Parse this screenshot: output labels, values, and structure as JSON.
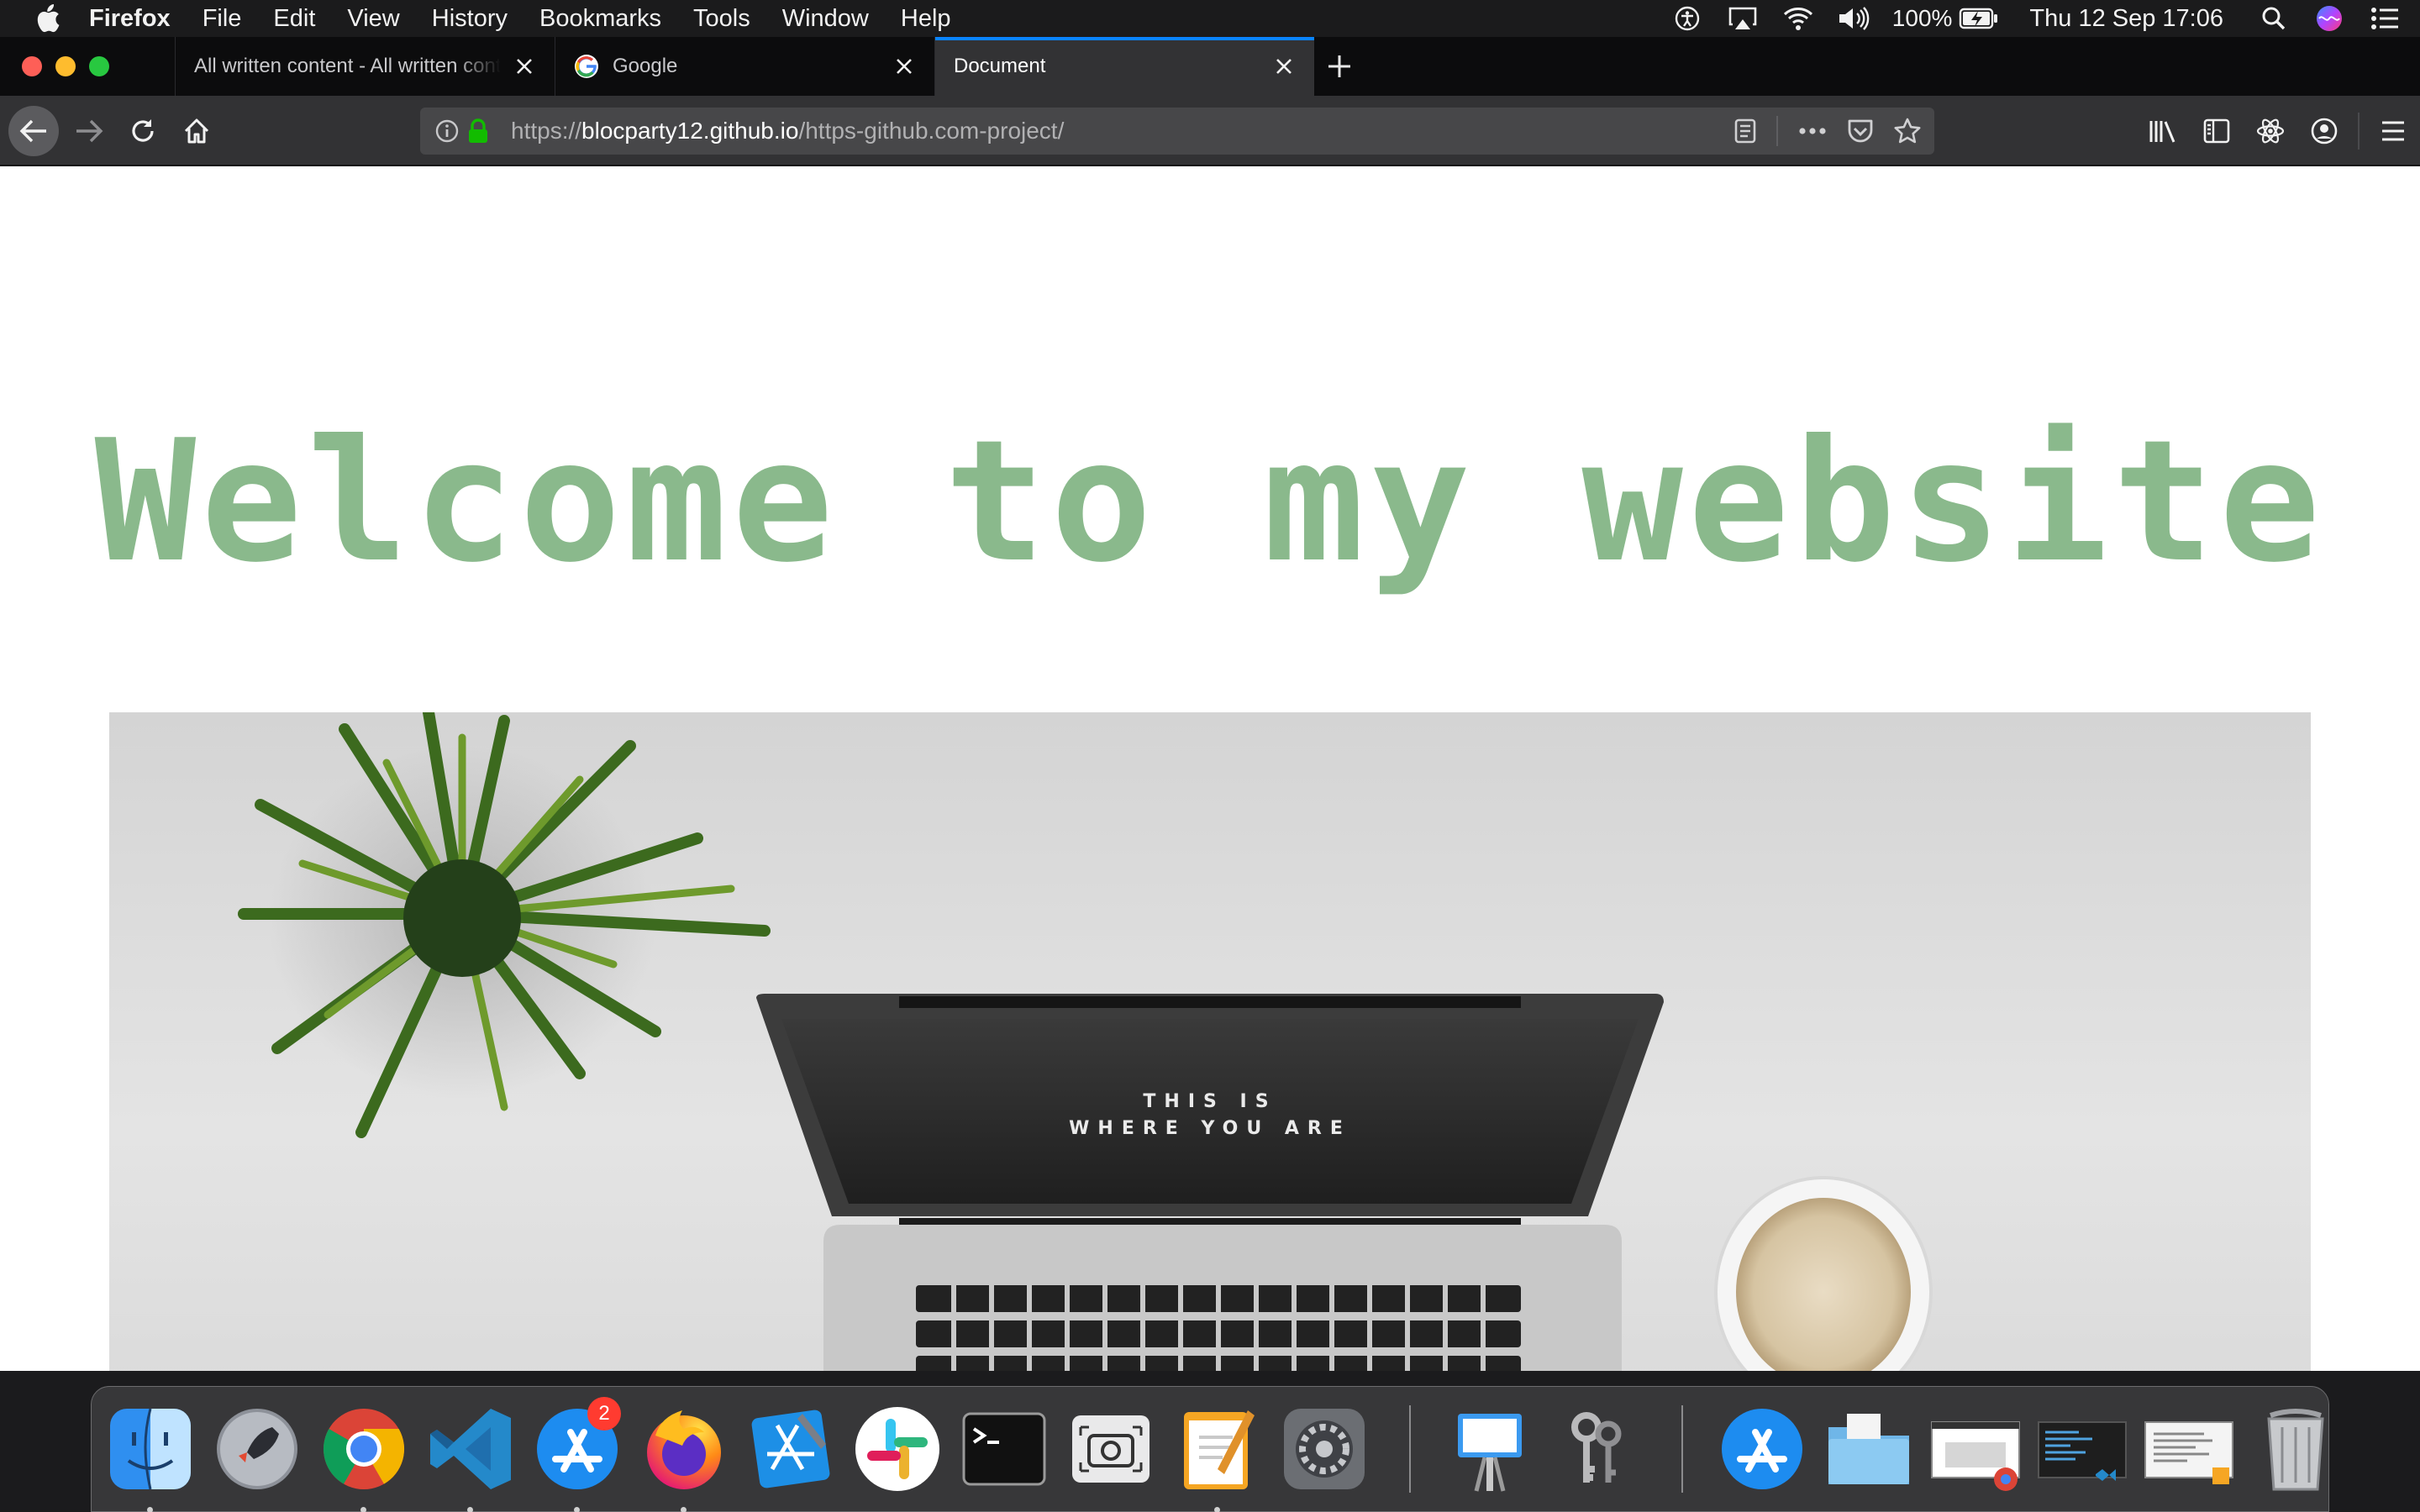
{
  "menubar": {
    "app_name": "Firefox",
    "items": [
      "File",
      "Edit",
      "View",
      "History",
      "Bookmarks",
      "Tools",
      "Window",
      "Help"
    ],
    "battery": "100%",
    "clock": "Thu 12 Sep  17:06"
  },
  "browser": {
    "tabs": [
      {
        "title": "All written content - All written content"
      },
      {
        "title": "Google"
      },
      {
        "title": "Document"
      }
    ],
    "url": {
      "scheme": "https://",
      "host": "blocparty12.github.io",
      "path": "/https-github.com-project/"
    }
  },
  "page": {
    "headline": "Welcome to my website",
    "headline_color": "#8ab98c",
    "laptop_screen_line1": "THIS IS",
    "laptop_screen_line2": "WHERE YOU ARE"
  },
  "dock": {
    "app_store_badge": "2"
  }
}
